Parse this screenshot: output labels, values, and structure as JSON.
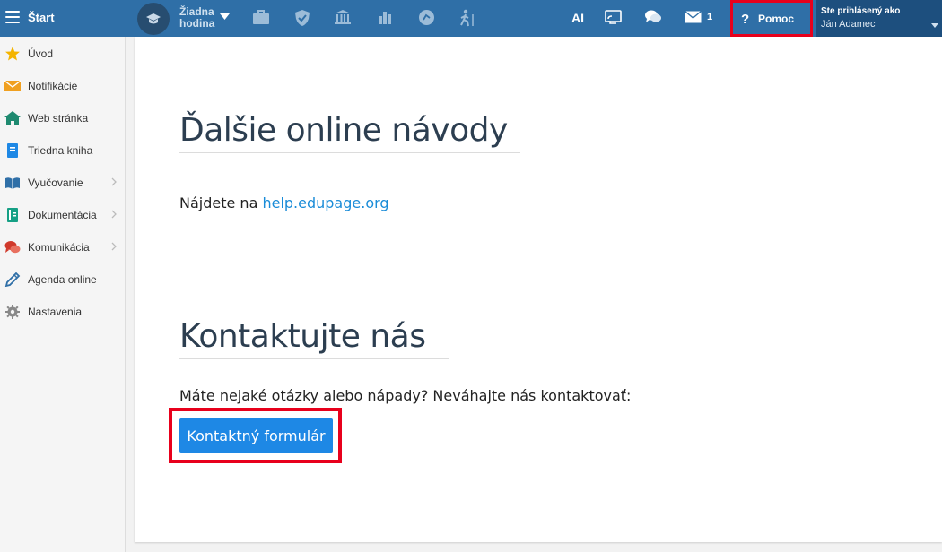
{
  "topbar": {
    "start_label": "Štart",
    "schedule_line1": "Žiadna",
    "schedule_line2": "hodina",
    "ai_label": "AI",
    "messages_count": "1",
    "help_label": "Pomoc",
    "help_glyph": "?",
    "user_title": "Ste prihlásený ako",
    "user_name": "Ján Adamec",
    "icons": [
      "briefcase-icon",
      "shield-icon",
      "bank-icon",
      "bar-chart-icon",
      "coin-icon",
      "walking-icon",
      "cast-icon",
      "chat-icon",
      "envelope-icon"
    ]
  },
  "sidebar": {
    "items": [
      {
        "label": "Úvod",
        "icon": "star-icon",
        "color": "#f4b400"
      },
      {
        "label": "Notifikácie",
        "icon": "envelope-icon",
        "color": "#f0a020"
      },
      {
        "label": "Web stránka",
        "icon": "house-icon",
        "color": "#1f8a70"
      },
      {
        "label": "Triedna kniha",
        "icon": "book-icon",
        "color": "#1e88e5"
      },
      {
        "label": "Vyučovanie",
        "icon": "open-book-icon",
        "color": "#2f6fa7",
        "has_submenu": true
      },
      {
        "label": "Dokumentácia",
        "icon": "document-icon",
        "color": "#16a085",
        "has_submenu": true
      },
      {
        "label": "Komunikácia",
        "icon": "speech-bubbles-icon",
        "color": "#d0392b",
        "has_submenu": true
      },
      {
        "label": "Agenda online",
        "icon": "pen-icon",
        "color": "#2f6fa7"
      },
      {
        "label": "Nastavenia",
        "icon": "gear-icon",
        "color": "#888888"
      }
    ]
  },
  "main": {
    "section1_title": "Ďalšie online návody",
    "section1_text_prefix": "Nájdete na ",
    "section1_link": "help.edupage.org",
    "section2_title": "Kontaktujte nás",
    "section2_text": "Máte nejaké otázky alebo nápady? Neváhajte nás kontaktovať:",
    "contact_button": "Kontaktný formulár"
  },
  "colors": {
    "topbar": "#2f6fa7",
    "highlight": "#e8001c",
    "button": "#1e88e5",
    "link": "#1a8cd8"
  }
}
